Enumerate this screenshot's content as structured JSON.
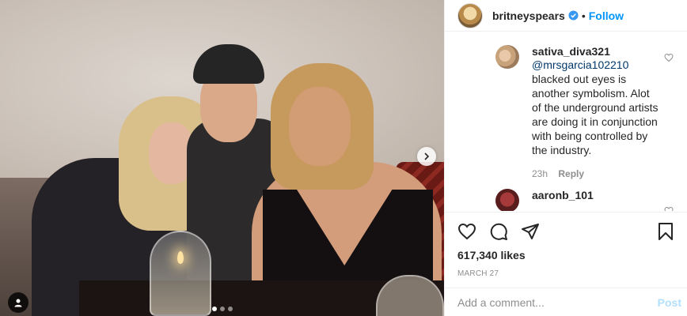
{
  "header": {
    "username": "britneyspears",
    "separator": "•",
    "follow_label": "Follow"
  },
  "comments": [
    {
      "username": "sativa_diva321",
      "mention": "@mrsgarcia102210",
      "text": "blacked out eyes is another symbolism. Alot of the underground artists are doing it in conjunction with being controlled by the industry.",
      "time": "23h",
      "reply_label": "Reply"
    },
    {
      "username": "aaronb_101"
    }
  ],
  "post": {
    "likes": "617,340 likes",
    "date": "MARCH 27",
    "carousel_count": 3,
    "carousel_active": 1
  },
  "composer": {
    "placeholder": "Add a comment...",
    "post_label": "Post"
  },
  "colors": {
    "link": "#0095f6",
    "post_disabled": "#b2dffc",
    "muted": "#8e8e8e"
  }
}
